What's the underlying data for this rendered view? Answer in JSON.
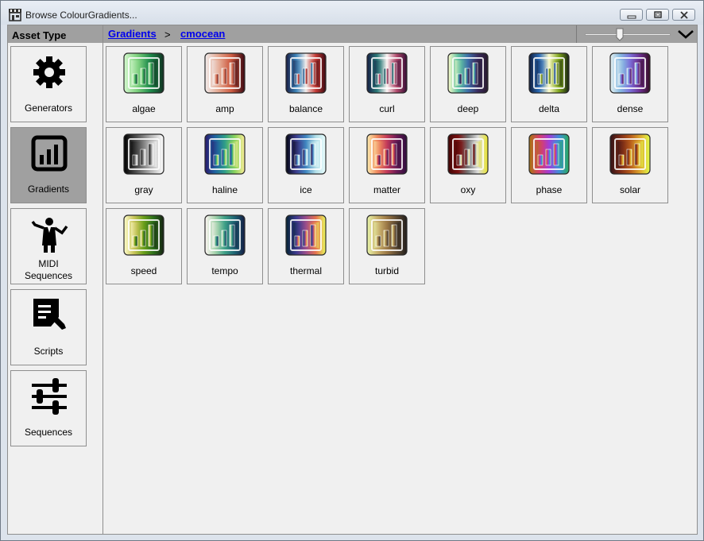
{
  "window": {
    "title": "Browse ColourGradients..."
  },
  "sidebar": {
    "header": "Asset Type",
    "items": [
      {
        "label": "Generators",
        "icon": "gear-icon"
      },
      {
        "label": "Gradients",
        "icon": "bar-chart-icon",
        "selected": true
      },
      {
        "label": "MIDI\nSequences",
        "icon": "conductor-icon"
      },
      {
        "label": "Scripts",
        "icon": "script-icon"
      },
      {
        "label": "Sequences",
        "icon": "sliders-icon"
      }
    ]
  },
  "breadcrumb": {
    "root": "Gradients",
    "separator": ">",
    "current": "cmocean"
  },
  "zoom": {
    "level": 0.4
  },
  "gradients": [
    {
      "name": "algae",
      "colors": [
        "#d6f9cf",
        "#7cd07d",
        "#1d8a4a",
        "#113222"
      ]
    },
    {
      "name": "amp",
      "colors": [
        "#f1ecec",
        "#e4a891",
        "#cd5b41",
        "#3c0912"
      ]
    },
    {
      "name": "balance",
      "colors": [
        "#181c43",
        "#3c83b8",
        "#f1ecea",
        "#c43a35",
        "#3c0912"
      ]
    },
    {
      "name": "curl",
      "colors": [
        "#151d44",
        "#2b7a78",
        "#fdf5f4",
        "#b0486a",
        "#340d35"
      ]
    },
    {
      "name": "deep",
      "colors": [
        "#fdfecc",
        "#5fc0a1",
        "#3c6ea8",
        "#392a5d",
        "#281a2c"
      ]
    },
    {
      "name": "delta",
      "colors": [
        "#111d3c",
        "#2a6ab6",
        "#fefccb",
        "#7ea41a",
        "#172312"
      ]
    },
    {
      "name": "dense",
      "colors": [
        "#e6f1f1",
        "#86b9e2",
        "#7b6ed8",
        "#6a2d8e",
        "#360e24"
      ]
    },
    {
      "name": "gray",
      "colors": [
        "#000000",
        "#555555",
        "#b0b0b0",
        "#ffffff"
      ]
    },
    {
      "name": "haline",
      "colors": [
        "#2a186c",
        "#1f63a0",
        "#2f9e88",
        "#8ad35c",
        "#fdee99"
      ]
    },
    {
      "name": "ice",
      "colors": [
        "#040613",
        "#3b3b8a",
        "#3f86c0",
        "#b4e0e8",
        "#eafdfd"
      ]
    },
    {
      "name": "matter",
      "colors": [
        "#fdedb0",
        "#f08a5e",
        "#c33a5a",
        "#6b1b56",
        "#2f0f3d"
      ]
    },
    {
      "name": "oxy",
      "colors": [
        "#400505",
        "#7a1010",
        "#777777",
        "#dcdcdc",
        "#e8e52d"
      ]
    },
    {
      "name": "phase",
      "colors": [
        "#a8780d",
        "#d83e6b",
        "#a13cd8",
        "#3e8fd9",
        "#2aab5e"
      ]
    },
    {
      "name": "solar",
      "colors": [
        "#331418",
        "#7b2a16",
        "#b5591a",
        "#dea62d",
        "#e1fd4b"
      ]
    },
    {
      "name": "speed",
      "colors": [
        "#fffdcd",
        "#c9c55a",
        "#6a9f1a",
        "#2b6e1b",
        "#172313"
      ]
    },
    {
      "name": "tempo",
      "colors": [
        "#fff6f4",
        "#a7d4ad",
        "#3ea087",
        "#1d6373",
        "#151d44"
      ]
    },
    {
      "name": "thermal",
      "colors": [
        "#042333",
        "#3b3a8e",
        "#9a4d8c",
        "#e6734f",
        "#e8fa5b"
      ]
    },
    {
      "name": "turbid",
      "colors": [
        "#e9f6ab",
        "#c9b06c",
        "#9b7845",
        "#5d4a33",
        "#221e1b"
      ]
    }
  ]
}
